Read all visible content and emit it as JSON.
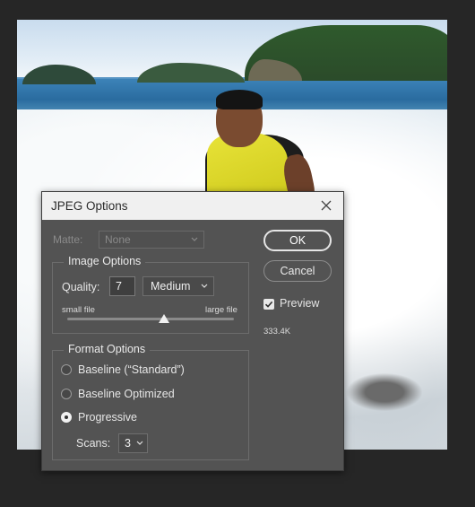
{
  "dialog": {
    "title": "JPEG Options",
    "matte": {
      "label": "Matte:",
      "value": "None"
    },
    "image_options": {
      "group_label": "Image Options",
      "quality_label": "Quality:",
      "quality_value": "7",
      "quality_preset": "Medium",
      "small_file_label": "small file",
      "large_file_label": "large file",
      "slider_position": 0.58
    },
    "format_options": {
      "group_label": "Format Options",
      "options": [
        {
          "label": "Baseline (“Standard”)",
          "selected": false
        },
        {
          "label": "Baseline Optimized",
          "selected": false
        },
        {
          "label": "Progressive",
          "selected": true
        }
      ],
      "scans_label": "Scans:",
      "scans_value": "3"
    },
    "buttons": {
      "ok": "OK",
      "cancel": "Cancel"
    },
    "preview": {
      "label": "Preview",
      "checked": true
    },
    "file_size": "333.4K"
  }
}
